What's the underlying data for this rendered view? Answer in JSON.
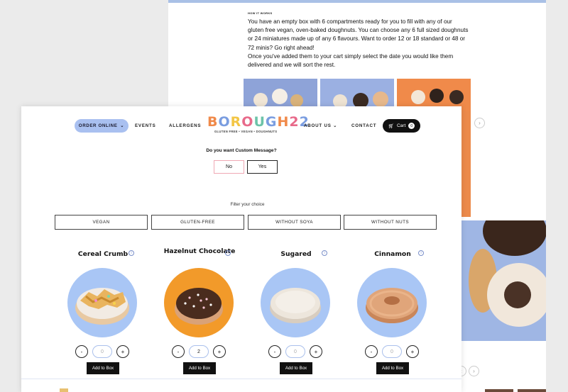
{
  "how_it_works": {
    "label": "HOW IT WORKS",
    "paragraph_1": "You have an empty box with 6 compartments ready for you to fill with any of our gluten free vegan, oven-baked doughnuts. You can choose any 6 full sized doughnuts or 24 miniatures made up of any 6 flavours. Want to order 12 or 18 standard or 48 or 72 minis? Go right ahead!",
    "paragraph_2": "Once you've added them to your cart simply select the date you would like them delivered and we will sort the rest."
  },
  "back_nav": {
    "next_icon": "chevron-right-icon",
    "prev_icon": "chevron-left-icon"
  },
  "nav": {
    "order_online": "ORDER ONLINE",
    "events": "EVENTS",
    "allergens": "ALLERGENS",
    "about_us": "ABOUT US",
    "contact": "CONTACT",
    "cart_label": "Cart",
    "cart_count": "0"
  },
  "logo": {
    "wordmark": "BOROUGH22",
    "tagline": "GLUTEN FREE • VEGAN • DOUGHNUTS",
    "letter_colors": [
      "#f08a4a",
      "#7a9de0",
      "#f3c645",
      "#e86a8a",
      "#6cc3a8",
      "#7a9de0",
      "#f08a4a",
      "#e86a8a",
      "#7a9de0"
    ]
  },
  "custom_message": {
    "question": "Do you want Custom Message?",
    "no_label": "No",
    "yes_label": "Yes"
  },
  "filter": {
    "label": "Filter your choice",
    "options": [
      "VEGAN",
      "GLUTEN-FREE",
      "WITHOUT SOYA",
      "WITHOUT NUTS"
    ]
  },
  "products": [
    {
      "name": "Cereal Crumb",
      "quantity": "0",
      "add_label": "Add to Box",
      "bg_color": "#a9c6f5"
    },
    {
      "name": "Hazelnut Chocolate",
      "quantity": "2",
      "add_label": "Add to Box",
      "bg_color": "#f29a2a"
    },
    {
      "name": "Sugared",
      "quantity": "0",
      "add_label": "Add to Box",
      "bg_color": "#a9c6f5"
    },
    {
      "name": "Cinnamon",
      "quantity": "0",
      "add_label": "Add to Box",
      "bg_color": "#a9c6f5"
    }
  ],
  "stepper": {
    "minus": "-",
    "plus": "+"
  },
  "colors": {
    "accent_blue": "#a9c0f0",
    "black_button": "#111111",
    "pink_border": "#f0a8b4"
  }
}
